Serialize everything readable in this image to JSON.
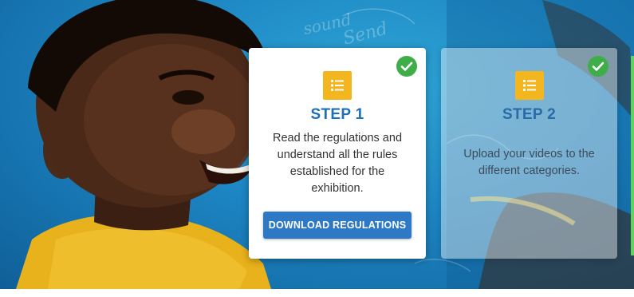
{
  "colors": {
    "board_blue": "#1d86c4",
    "step_blue": "#1f6fb7",
    "icon_yellow": "#f3b61f",
    "check_green": "#3fae49",
    "button_blue": "#2d79c5"
  },
  "hero": {
    "chalk_words": [
      "sound",
      "Send"
    ]
  },
  "steps": [
    {
      "title": "STEP 1",
      "description": "Read the regulations and understand all the rules established for the exhibition.",
      "button_label": "DOWNLOAD REGULATIONS",
      "icon": "list-icon",
      "completed_icon": "check-circle-icon"
    },
    {
      "title": "STEP 2",
      "description": "Upload your videos to the different categories.",
      "icon": "list-icon",
      "completed_icon": "check-circle-icon"
    }
  ]
}
